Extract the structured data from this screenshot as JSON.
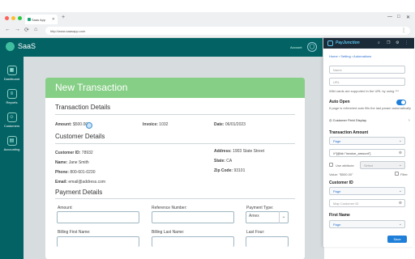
{
  "browser": {
    "tab_title": "Saas App",
    "url": "http://www.saasapp.com",
    "tab_close": "✕",
    "newtab": "+",
    "win_min": "—",
    "win_max": "□",
    "win_close": "✕",
    "nav_back": "←",
    "nav_forward": "→",
    "nav_reload": "⟳",
    "nav_home": "⌂",
    "menu": "⋮"
  },
  "app": {
    "brand": "SaaS",
    "account_label": "Account",
    "nav": [
      {
        "label": "Dashboard",
        "icon": "dashboard-icon",
        "glyph": "▦"
      },
      {
        "label": "Reports",
        "icon": "reports-icon",
        "glyph": "≡"
      },
      {
        "label": "Customers",
        "icon": "customers-icon",
        "glyph": "☺"
      },
      {
        "label": "Accounting",
        "icon": "accounting-icon",
        "glyph": "▤"
      }
    ]
  },
  "form": {
    "title": "New Transaction",
    "transaction_details": "Transaction Details",
    "amount_label": "Amount:",
    "amount_value": "$500.00",
    "invoice_label": "Invoice:",
    "invoice_value": "1032",
    "date_label": "Date:",
    "date_value": "06/01/2023",
    "customer_details": "Customer Details",
    "customer_id_label": "Customer ID:",
    "customer_id_value": "78932",
    "name_label": "Name:",
    "name_value": "Jane Smith",
    "phone_label": "Phone:",
    "phone_value": "800-601-0230",
    "email_label": "Email:",
    "email_value": "email@address.com",
    "address_label": "Address:",
    "address_value": "1903 State Street",
    "state_label": "State:",
    "state_value": "CA",
    "zip_label": "Zip Code:",
    "zip_value": "93101",
    "payment_details": "Payment Details",
    "pay_amount_label": "Amount:",
    "reference_label": "Reference Number:",
    "payment_type_label": "Payment Type:",
    "payment_type_value": "Amex",
    "billing_first_label": "Billing First Name:",
    "billing_last_label": "Billing Last Name:",
    "last_four_label": "Last Four:",
    "select_chevron": "⌄"
  },
  "panel": {
    "brand": "PayJunction",
    "crumb_home": "Home",
    "crumb_setting": "Setting",
    "crumb_current": "Automations",
    "name_placeholder": "Name",
    "url_placeholder": "URL",
    "url_note": "Wild cards are supported in the URL by using ***",
    "auto_open_label": "Auto Open",
    "auto_open_note": "If page is refreshed auto fills the last param automatically",
    "customer_field_display": "Customer Field Display",
    "transaction_amount_label": "Transaction Amount",
    "page_option": "Page",
    "amount_selector": "//*[@id=\"invoice_amount\"]",
    "use_attribute": "Use attribute",
    "attr_select": "Select",
    "value_hint": "Value: \"$500.00\"",
    "filter_label": "Filter",
    "customer_id_label": "Customer ID",
    "customer_id_placeholder": "Map Customer ID",
    "first_name_label": "First Name",
    "save_label": "Save"
  },
  "colors": {
    "sidebar": "#036264",
    "card_header": "#86cf86",
    "accent": "#1f7fd8"
  }
}
